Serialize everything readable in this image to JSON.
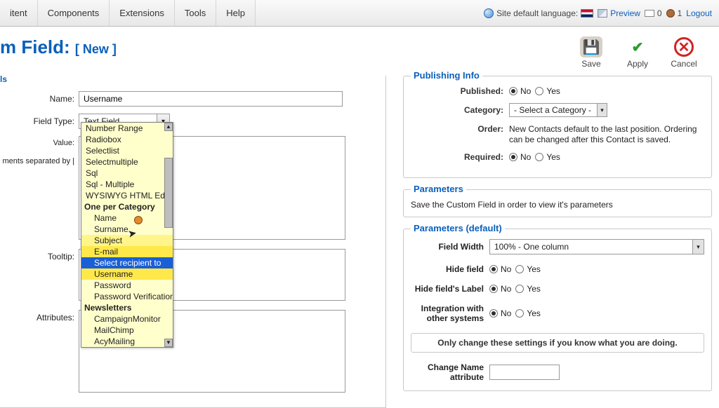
{
  "menubar": {
    "items": [
      "itent",
      "Components",
      "Extensions",
      "Tools",
      "Help"
    ],
    "status": {
      "lang_label": "Site default language:",
      "preview": "Preview",
      "mail_count": "0",
      "user_count": "1",
      "logout": "Logout"
    }
  },
  "title": {
    "main": "m Field:",
    "bracket": "[ New ]"
  },
  "actions": {
    "save": "Save",
    "apply": "Apply",
    "cancel": "Cancel"
  },
  "left_panel": {
    "legend": "ls"
  },
  "form": {
    "name_label": "Name:",
    "name_value": "Username",
    "type_label": "Field Type:",
    "type_value": "Text Field",
    "value_label": "Value:",
    "value_hint": "ments separated by |",
    "tooltip_label": "Tooltip:",
    "attributes_label": "Attributes:"
  },
  "dropdown": {
    "items": [
      {
        "t": "Number Range",
        "g": false
      },
      {
        "t": "Radiobox",
        "g": false
      },
      {
        "t": "Selectlist",
        "g": false
      },
      {
        "t": "Selectmultiple",
        "g": false
      },
      {
        "t": "Sql",
        "g": false
      },
      {
        "t": "Sql - Multiple",
        "g": false
      },
      {
        "t": "WYSIWYG HTML Editor",
        "g": false
      },
      {
        "t": "One per Category",
        "g": true
      },
      {
        "t": "Name",
        "g": false,
        "c": true
      },
      {
        "t": "Surname",
        "g": false,
        "c": true
      },
      {
        "t": "Subject",
        "g": false,
        "c": true,
        "hv": 2
      },
      {
        "t": "E-mail",
        "g": false,
        "c": true,
        "hv": 1
      },
      {
        "t": "Select recipient to",
        "g": false,
        "c": true,
        "sel": true
      },
      {
        "t": "Username",
        "g": false,
        "c": true,
        "hv": 1
      },
      {
        "t": "Password",
        "g": false,
        "c": true
      },
      {
        "t": "Password Verification",
        "g": false,
        "c": true
      },
      {
        "t": "Newsletters",
        "g": true
      },
      {
        "t": "CampaignMonitor",
        "g": false,
        "c": true
      },
      {
        "t": "MailChimp",
        "g": false,
        "c": true
      },
      {
        "t": "AcyMailing",
        "g": false,
        "c": true
      }
    ]
  },
  "publish": {
    "legend": "Publishing Info",
    "published_label": "Published:",
    "category_label": "Category:",
    "category_value": "- Select a Category -",
    "order_label": "Order:",
    "order_text": "New Contacts default to the last position. Ordering can be changed after this Contact is saved.",
    "required_label": "Required:",
    "no": "No",
    "yes": "Yes"
  },
  "params_meta": {
    "legend": "Parameters",
    "note": "Save the Custom Field in order to view it's parameters"
  },
  "params": {
    "legend": "Parameters (default)",
    "field_width_label": "Field Width",
    "field_width_value": "100% - One column",
    "hide_field_label": "Hide field",
    "hide_label_label": "Hide field's Label",
    "integration_label": "Integration with other systems",
    "warn": "Only change these settings if you know what you are doing.",
    "change_name_label": "Change Name attribute",
    "no": "No",
    "yes": "Yes"
  }
}
